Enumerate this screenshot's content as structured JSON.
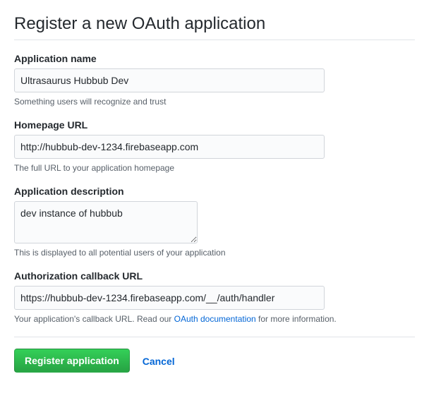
{
  "page_title": "Register a new OAuth application",
  "fields": {
    "app_name": {
      "label": "Application name",
      "value": "Ultrasaurus Hubbub Dev",
      "help": "Something users will recognize and trust"
    },
    "homepage_url": {
      "label": "Homepage URL",
      "value": "http://hubbub-dev-1234.firebaseapp.com",
      "help": "The full URL to your application homepage"
    },
    "description": {
      "label": "Application description",
      "value": "dev instance of hubbub",
      "help": "This is displayed to all potential users of your application"
    },
    "callback_url": {
      "label": "Authorization callback URL",
      "value": "https://hubbub-dev-1234.firebaseapp.com/__/auth/handler",
      "help_prefix": "Your application's callback URL. Read our ",
      "help_link_text": "OAuth documentation",
      "help_suffix": " for more information."
    }
  },
  "actions": {
    "submit_label": "Register application",
    "cancel_label": "Cancel"
  }
}
